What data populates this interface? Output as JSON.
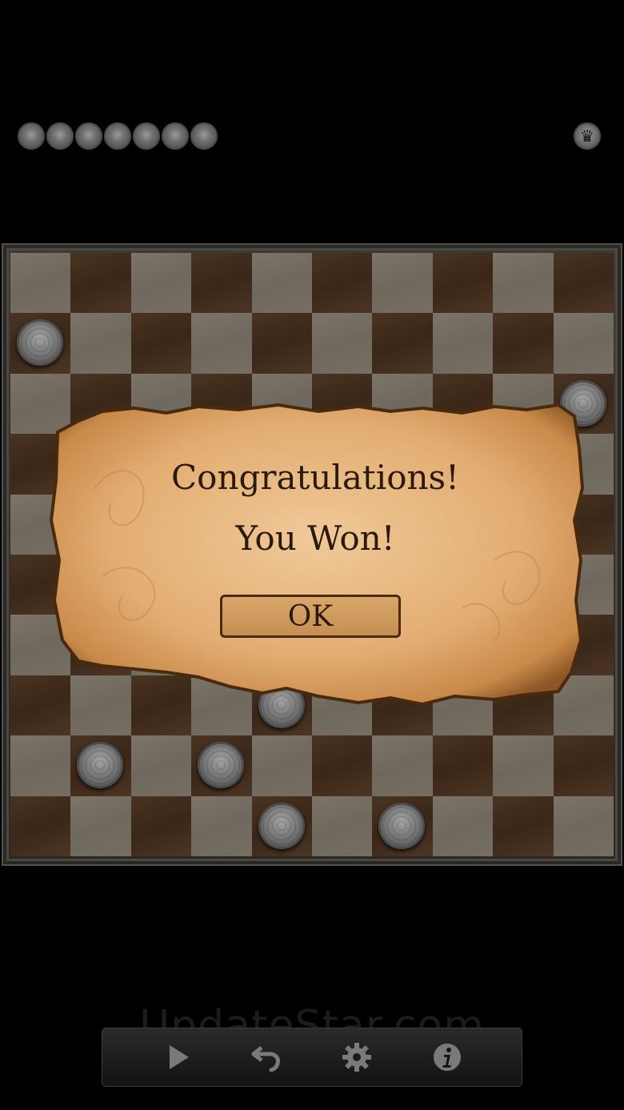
{
  "captured_pieces": {
    "count": 7
  },
  "king_badge": {
    "icon": "crown-icon"
  },
  "board": {
    "size": 10,
    "light_color": "#766e62",
    "dark_color": "#3f2a1a",
    "pieces": [
      {
        "row": 1,
        "col": 0
      },
      {
        "row": 2,
        "col": 9
      },
      {
        "row": 7,
        "col": 4
      },
      {
        "row": 8,
        "col": 1
      },
      {
        "row": 8,
        "col": 3
      },
      {
        "row": 9,
        "col": 4
      },
      {
        "row": 9,
        "col": 6
      }
    ]
  },
  "dialog": {
    "title": "Congratulations!",
    "message": "You Won!",
    "ok_label": "OK"
  },
  "watermark": "UpdateStar.com",
  "toolbar": {
    "buttons": [
      {
        "name": "play-button",
        "icon": "play-icon"
      },
      {
        "name": "undo-button",
        "icon": "undo-icon"
      },
      {
        "name": "settings-button",
        "icon": "gear-icon"
      },
      {
        "name": "info-button",
        "icon": "info-icon"
      }
    ]
  }
}
